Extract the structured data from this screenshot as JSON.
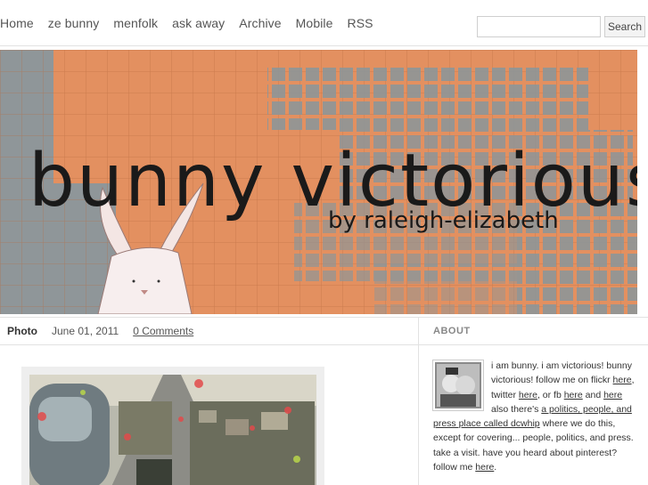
{
  "nav": {
    "items": [
      "Home",
      "ze bunny",
      "menfolk",
      "ask away",
      "Archive",
      "Mobile",
      "RSS"
    ]
  },
  "search": {
    "placeholder": "",
    "button_label": "Search"
  },
  "banner": {
    "title": "bunny victorious!",
    "byline": "by raleigh-elizabeth",
    "colors": {
      "orange": "#e39060",
      "grey": "#8f9699",
      "ink": "#1a1a1a"
    }
  },
  "post": {
    "type_label": "Photo",
    "date": "June 01, 2011",
    "comments_label": "0 Comments"
  },
  "sidebar": {
    "about_title": "ABOUT",
    "about": {
      "t1": "i am bunny. i am victorious! bunny victorious! follow me on flickr ",
      "l1": "here",
      "t2": ", twitter ",
      "l2": "here",
      "t3": ", or fb ",
      "l3": "here",
      "t4": " and ",
      "l4": "here",
      "t5": " also there's ",
      "l5": "a politics, people, and press place called dcwhip",
      "t6": " where we do this, except for covering... people, politics, and press. take a visit. have you heard about pinterest? follow me ",
      "l6": "here",
      "t7": "."
    }
  }
}
